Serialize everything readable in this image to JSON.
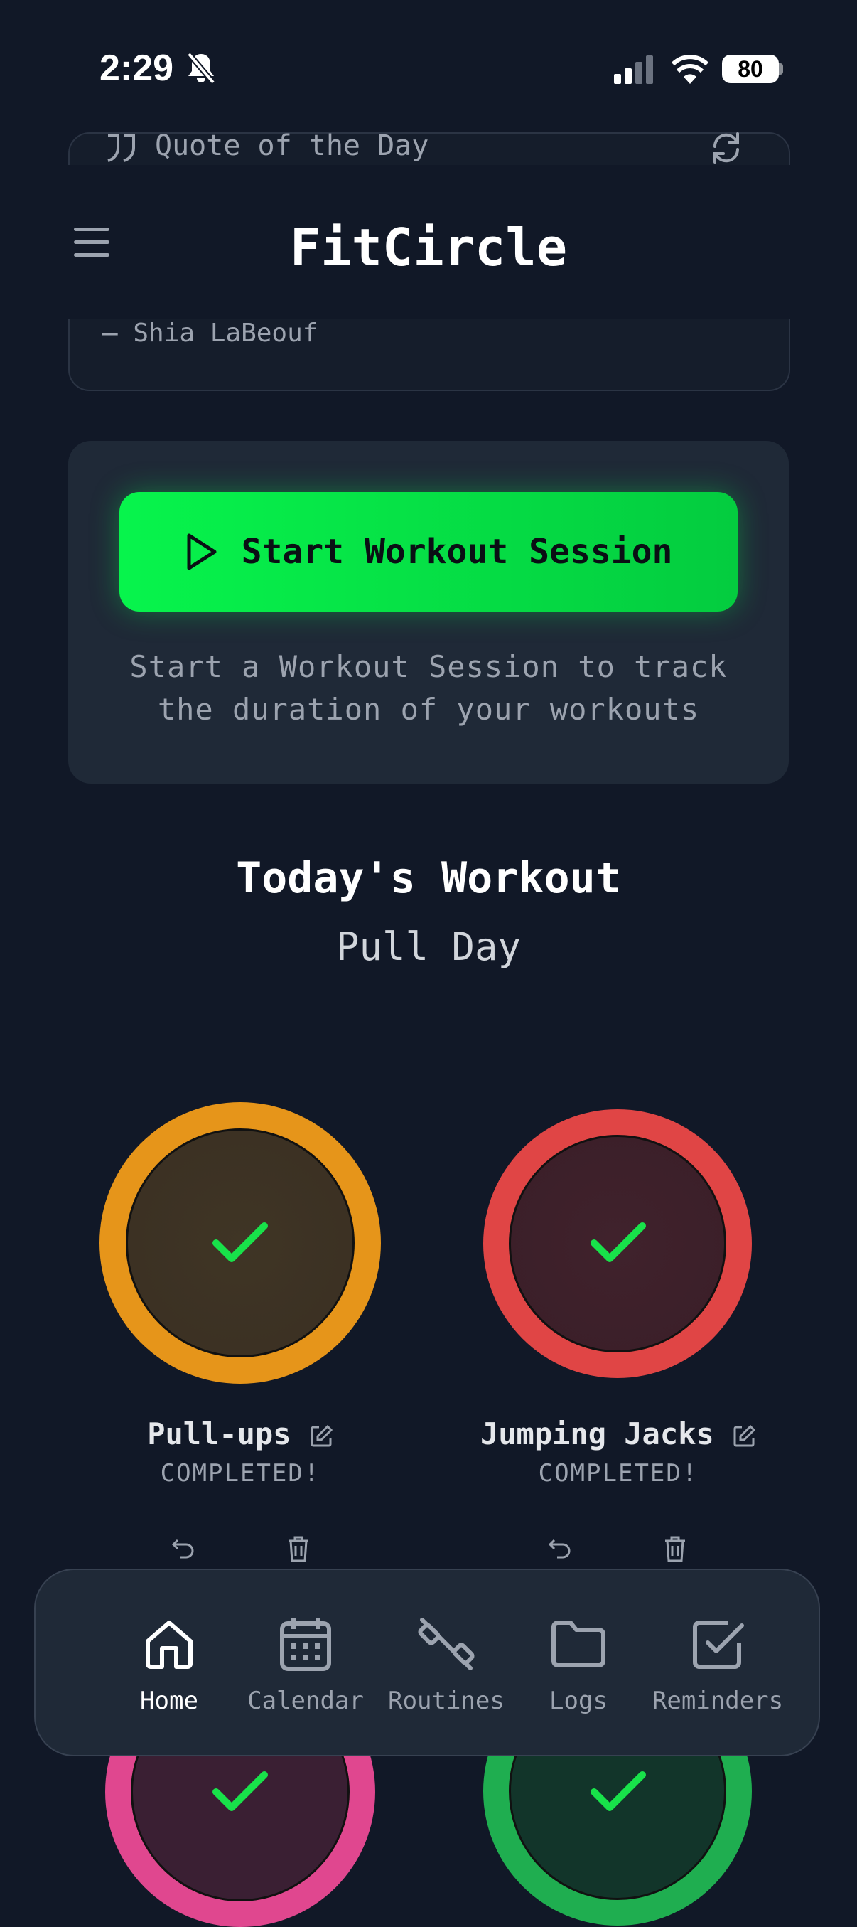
{
  "status_bar": {
    "time": "2:29",
    "battery": "80"
  },
  "quote": {
    "title": "Quote of the Day",
    "author": "— Shia LaBeouf"
  },
  "header": {
    "title": "FitCircle"
  },
  "session": {
    "button_label": "Start Workout Session",
    "hint": "Start a Workout Session to track the duration of your workouts"
  },
  "today": {
    "title": "Today's Workout",
    "routine": "Pull Day"
  },
  "exercises": [
    {
      "name": "Pull-ups",
      "status": "COMPLETED!",
      "color": "#e6951a"
    },
    {
      "name": "Jumping Jacks",
      "status": "COMPLETED!",
      "color": "#e04545"
    },
    {
      "color": "#e0478f"
    },
    {
      "color": "#1fae50"
    }
  ],
  "nav": {
    "items": [
      {
        "label": "Home",
        "icon": "home-icon",
        "active": true
      },
      {
        "label": "Calendar",
        "icon": "calendar-icon"
      },
      {
        "label": "Routines",
        "icon": "dumbbell-icon"
      },
      {
        "label": "Logs",
        "icon": "folder-icon"
      },
      {
        "label": "Reminders",
        "icon": "checkbox-icon"
      }
    ]
  },
  "colors": {
    "accent": "#07f44c",
    "background": "#111827",
    "card": "#1f2937"
  }
}
